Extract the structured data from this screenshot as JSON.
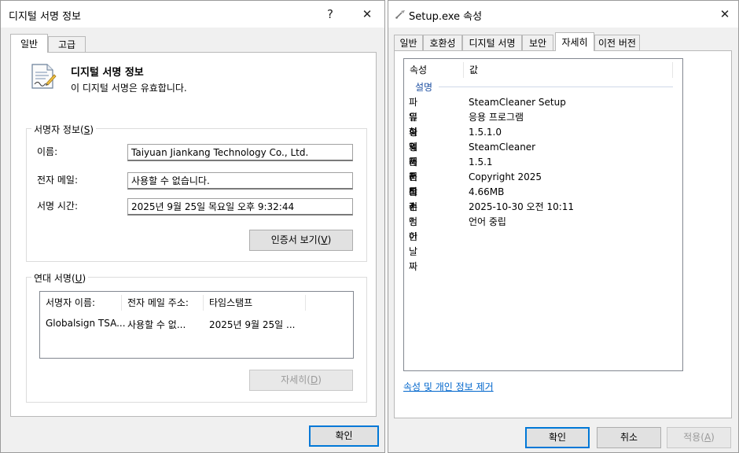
{
  "left_window": {
    "title": "디지털 서명 정보",
    "help_glyph": "?",
    "close_glyph": "✕",
    "tabs": [
      {
        "label": "일반",
        "active": true
      },
      {
        "label": "고급",
        "active": false
      }
    ],
    "header": {
      "title": "디지털 서명 정보",
      "status": "이 디지털 서명은 유효합니다."
    },
    "signer": {
      "group_label": "서명자 정보",
      "group_key": "S",
      "name_label": "이름:",
      "name_value": "Taiyuan Jiankang Technology Co., Ltd.",
      "email_label": "전자 메일:",
      "email_value": "사용할 수 없습니다.",
      "time_label": "서명 시간:",
      "time_value": "2025년 9월 25일 목요일 오후 9:32:44",
      "view_cert_label": "인증서 보기",
      "view_cert_key": "V"
    },
    "countersign": {
      "group_label": "연대 서명",
      "group_key": "U",
      "columns": [
        "서명자 이름:",
        "전자 메일 주소:",
        "타임스탬프"
      ],
      "rows": [
        [
          "Globalsign TSA...",
          "사용할 수 없...",
          "2025년 9월 25일 ..."
        ]
      ],
      "details_label": "자세히",
      "details_key": "D"
    },
    "ok_label": "확인"
  },
  "right_window": {
    "title": "Setup.exe 속성",
    "close_glyph": "✕",
    "tabs": [
      {
        "label": "일반",
        "active": false
      },
      {
        "label": "호환성",
        "active": false
      },
      {
        "label": "디지털 서명",
        "active": false
      },
      {
        "label": "보안",
        "active": false
      },
      {
        "label": "자세히",
        "active": true
      },
      {
        "label": "이전 버전",
        "active": false
      }
    ],
    "list_header": {
      "property": "속성",
      "value": "값"
    },
    "section": "설명",
    "properties": [
      {
        "key": "파일 설명",
        "value": "SteamCleaner Setup"
      },
      {
        "key": "유형",
        "value": "응용 프로그램"
      },
      {
        "key": "파일 버전",
        "value": "1.5.1.0"
      },
      {
        "key": "제품 이름",
        "value": "SteamCleaner"
      },
      {
        "key": "제품 버전",
        "value": "1.5.1"
      },
      {
        "key": "저작권",
        "value": "Copyright 2025"
      },
      {
        "key": "크기",
        "value": "4.66MB"
      },
      {
        "key": "수정한 날짜",
        "value": "2025-10-30 오전 10:11"
      },
      {
        "key": "언어",
        "value": "언어 중립"
      }
    ],
    "remove_info_link": "속성 및 개인 정보 제거",
    "ok_label": "확인",
    "cancel_label": "취소",
    "apply_label": "적용",
    "apply_key": "A"
  },
  "icons": {
    "certificate": "certificate-document-icon",
    "properties": "properties-icon"
  }
}
